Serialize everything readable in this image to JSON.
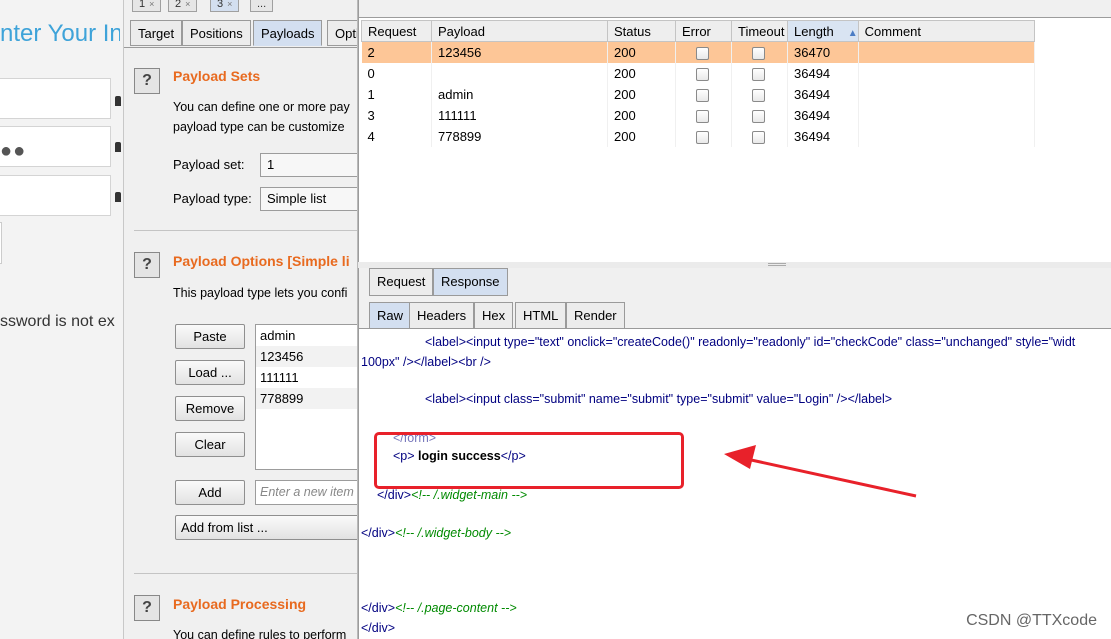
{
  "browser": {
    "heading": "nter Your In",
    "password_dots": "●●",
    "error_text": "ssword is not ex"
  },
  "intruder": {
    "top_tabs": [
      {
        "label": "1"
      },
      {
        "label": "2"
      },
      {
        "label": "3"
      },
      {
        "label": "..."
      }
    ],
    "sub_tabs": [
      {
        "label": "Target"
      },
      {
        "label": "Positions"
      },
      {
        "label": "Payloads"
      },
      {
        "label": "Opti"
      }
    ],
    "payload_sets": {
      "title": "Payload Sets",
      "desc_line1": "You can define one or more pay",
      "desc_line2": "payload type can be customize",
      "set_label": "Payload set:",
      "set_value": "1",
      "type_label": "Payload type:",
      "type_value": "Simple list"
    },
    "payload_options": {
      "title": "Payload Options [Simple li",
      "desc": "This payload type lets you confi",
      "buttons": {
        "paste": "Paste",
        "load": "Load ...",
        "remove": "Remove",
        "clear": "Clear",
        "add": "Add",
        "add_from_list": "Add from list ..."
      },
      "items": [
        "admin",
        "123456",
        "111111",
        "778899"
      ],
      "new_item_placeholder": "Enter a new item"
    },
    "payload_processing": {
      "title": "Payload Processing",
      "desc": "You can define rules to perform"
    }
  },
  "results": {
    "columns": [
      "Request",
      "Payload",
      "Status",
      "Error",
      "Timeout",
      "Length",
      "Comment"
    ],
    "rows": [
      {
        "request": "2",
        "payload": "123456",
        "status": "200",
        "length": "36470",
        "selected": true
      },
      {
        "request": "0",
        "payload": "",
        "status": "200",
        "length": "36494",
        "selected": false
      },
      {
        "request": "1",
        "payload": "admin",
        "status": "200",
        "length": "36494",
        "selected": false
      },
      {
        "request": "3",
        "payload": "111111",
        "status": "200",
        "length": "36494",
        "selected": false
      },
      {
        "request": "4",
        "payload": "778899",
        "status": "200",
        "length": "36494",
        "selected": false
      }
    ]
  },
  "viewer": {
    "rr_tabs": [
      {
        "label": "Request"
      },
      {
        "label": "Response"
      }
    ],
    "view_tabs": [
      {
        "label": "Raw"
      },
      {
        "label": "Headers"
      },
      {
        "label": "Hex"
      },
      {
        "label": "HTML"
      },
      {
        "label": "Render"
      }
    ],
    "code": {
      "l1_input_attrs": "type=\"text\" onclick=\"createCode()\" readonly=\"readonly\" id=\"checkCode\" class=\"unchanged\" style=\"widt",
      "l1b": "100px\" />",
      "l2_input_attrs": "class=\"submit\"  name=\"submit\" type=\"submit\" value=\"Login\" />",
      "success_text": " login success",
      "cmt_widget_main": "<!-- /.widget-main -->",
      "cmt_widget_body": "<!-- /.widget-body -->",
      "cmt_page_content": "<!-- /.page-content -->"
    }
  },
  "watermark": "CSDN @TTXcode",
  "colors": {
    "selected_row": "#fdc697",
    "section_title": "#e86a1f",
    "annotation": "#e8212a"
  }
}
